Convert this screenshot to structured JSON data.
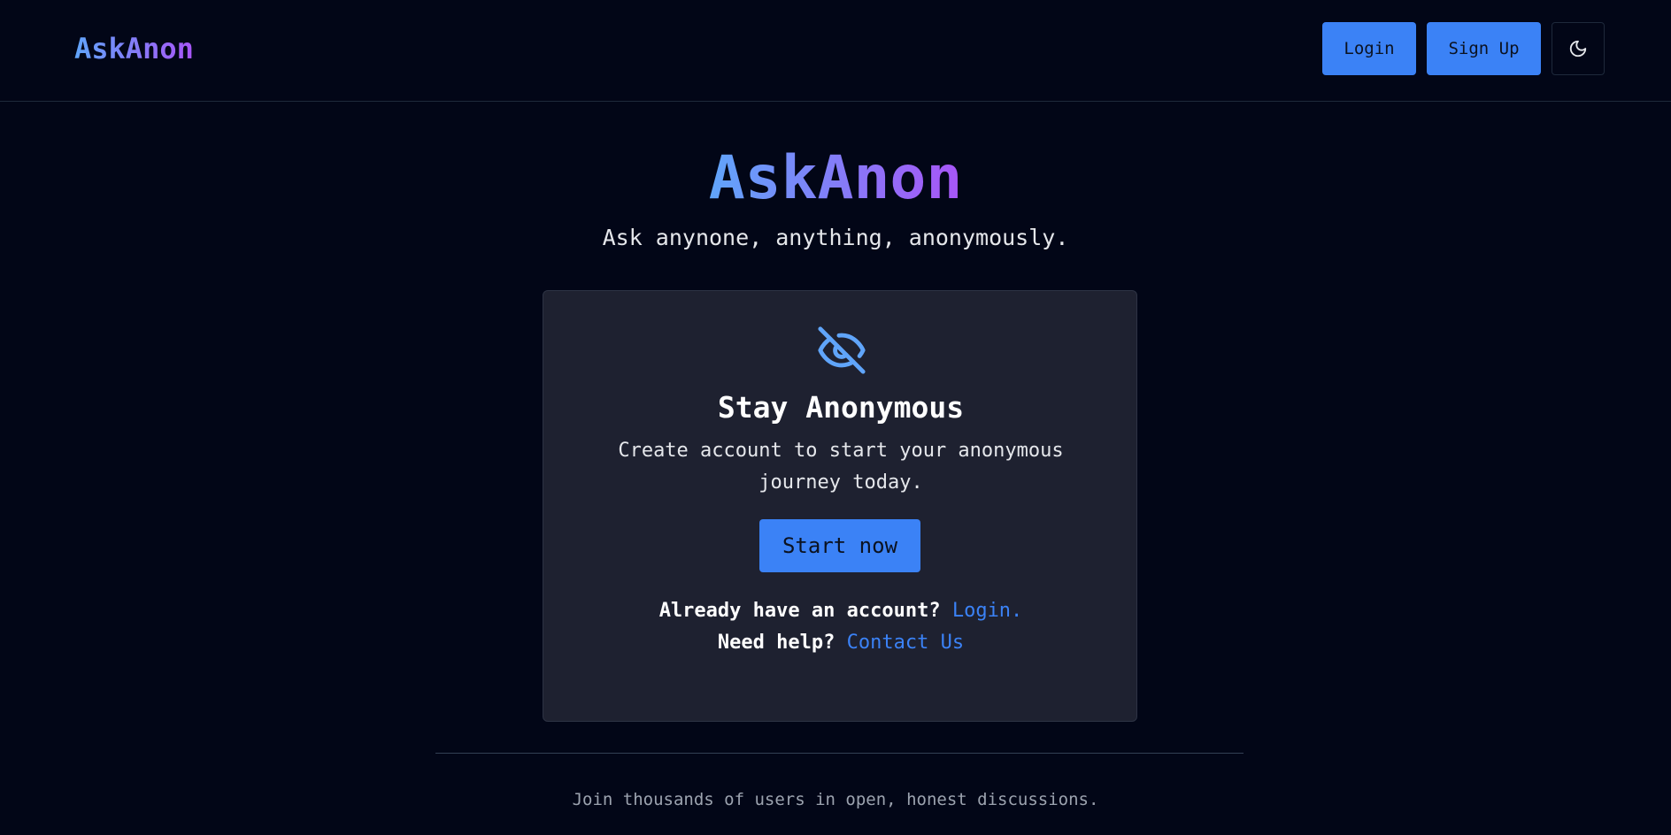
{
  "navbar": {
    "brand": "AskAnon",
    "login_label": "Login",
    "signup_label": "Sign Up",
    "theme_icon": "moon-icon"
  },
  "hero": {
    "title": "AskAnon",
    "subtitle": "Ask anynone, anything, anonymously."
  },
  "card": {
    "icon": "eye-off-icon",
    "title": "Stay Anonymous",
    "description": "Create account to start your anonymous journey today.",
    "cta_label": "Start now",
    "login_prompt": "Already have an account?",
    "login_link": "Login.",
    "help_prompt": "Need help?",
    "help_link": "Contact Us"
  },
  "footer": {
    "text": "Join thousands of users in open, honest discussions."
  },
  "colors": {
    "background": "#020617",
    "accent": "#3b82f6",
    "gradient_start": "#60a5fa",
    "gradient_end": "#a855f7",
    "card": "#1e2130"
  }
}
